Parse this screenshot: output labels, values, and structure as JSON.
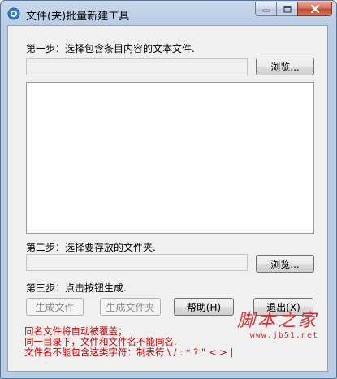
{
  "window": {
    "title": "文件(夹)批量新建工具"
  },
  "step1": {
    "label": "第一步：选择包含条目内容的文本文件.",
    "path_value": "",
    "browse_label": "浏览..."
  },
  "step2": {
    "label": "第二步：选择要存放的文件夹.",
    "path_value": "",
    "browse_label": "浏览..."
  },
  "step3": {
    "label": "第三步：点击按钮生成."
  },
  "buttons": {
    "create_files": "生成文件",
    "create_folders": "生成文件夹",
    "help": "帮助(H)",
    "exit": "退出(X)"
  },
  "notes": [
    "同名文件将自动被覆盖；",
    "同一目录下，文件和文件名不能同名.",
    "文件名不能包含这类字符：制表符 \\ / : * ? \" < > |"
  ],
  "watermark": {
    "main": "脚本之家",
    "sub": "www.jb51.net"
  }
}
